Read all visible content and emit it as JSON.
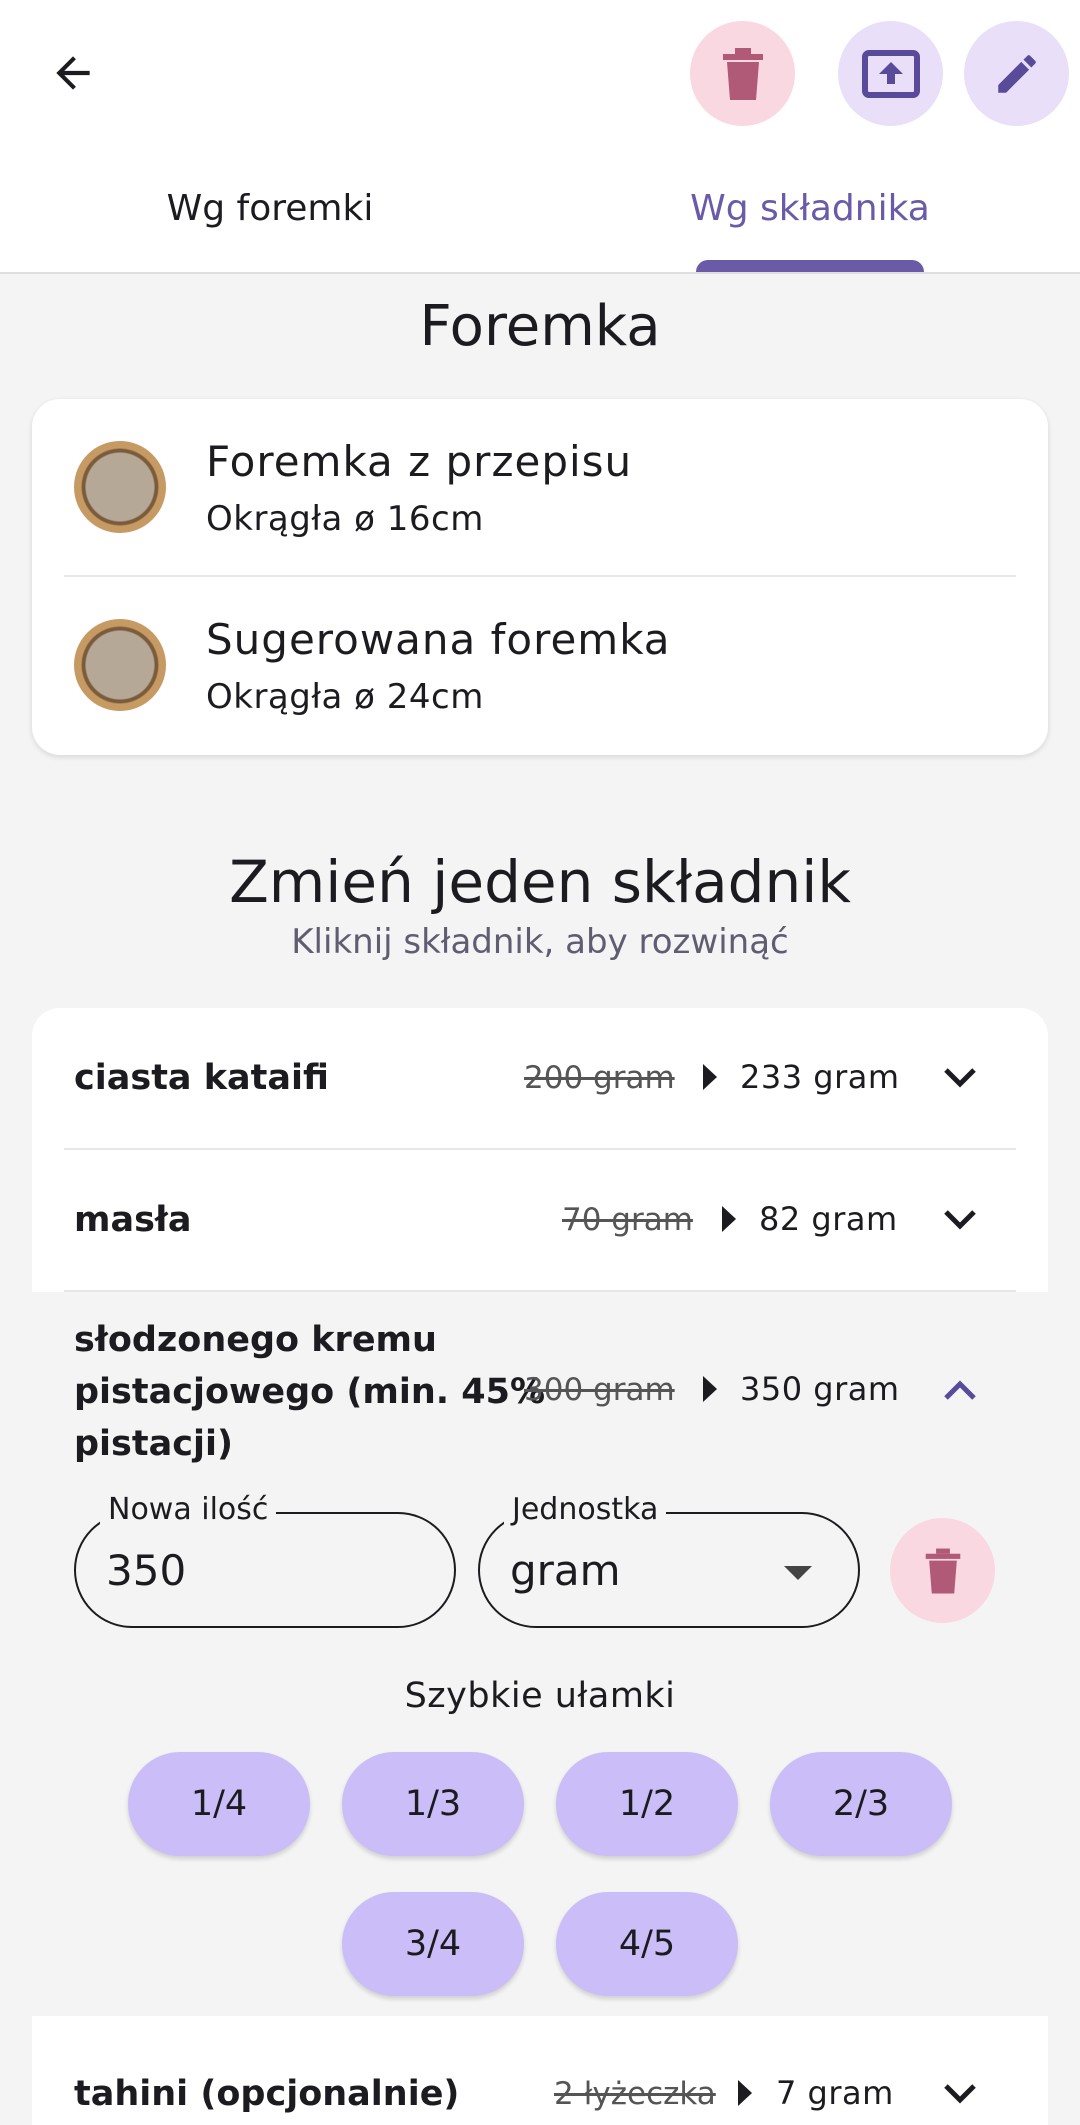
{
  "tabs": [
    "Wg foremki",
    "Wg składnika"
  ],
  "pan_section": {
    "title": "Foremka",
    "rows": [
      {
        "title": "Foremka z przepisu",
        "subtitle": "Okrągła ø 16cm"
      },
      {
        "title": "Sugerowana foremka",
        "subtitle": "Okrągła ø 24cm"
      }
    ]
  },
  "ingredient_section": {
    "title": "Zmień jeden składnik",
    "subtitle": "Kliknij składnik, aby rozwinąć",
    "items": [
      {
        "name": "ciasta kataifi",
        "old": "200 gram",
        "new": "233 gram"
      },
      {
        "name": "masła",
        "old": "70 gram",
        "new": "82 gram"
      },
      {
        "name_lines": [
          "słodzonego kremu",
          "pistacjowego (min. 45%",
          "pistacji)"
        ],
        "old": "300 gram",
        "new": "350 gram"
      },
      {
        "name": "tahini (opcjonalnie)",
        "old": "2 łyżeczka",
        "new": "7 gram"
      }
    ]
  },
  "editor": {
    "amount_label": "Nowa ilość",
    "amount_value": "350",
    "unit_label": "Jednostka",
    "unit_value": "gram",
    "quick_label": "Szybkie ułamki",
    "fractions": [
      "1/4",
      "1/3",
      "1/2",
      "2/3",
      "3/4",
      "4/5"
    ]
  },
  "colors": {
    "accent": "#6a5aa8",
    "chip": "#cbbdf7",
    "danger_bg": "#f9d8e2",
    "danger_icon": "#b05a78"
  }
}
